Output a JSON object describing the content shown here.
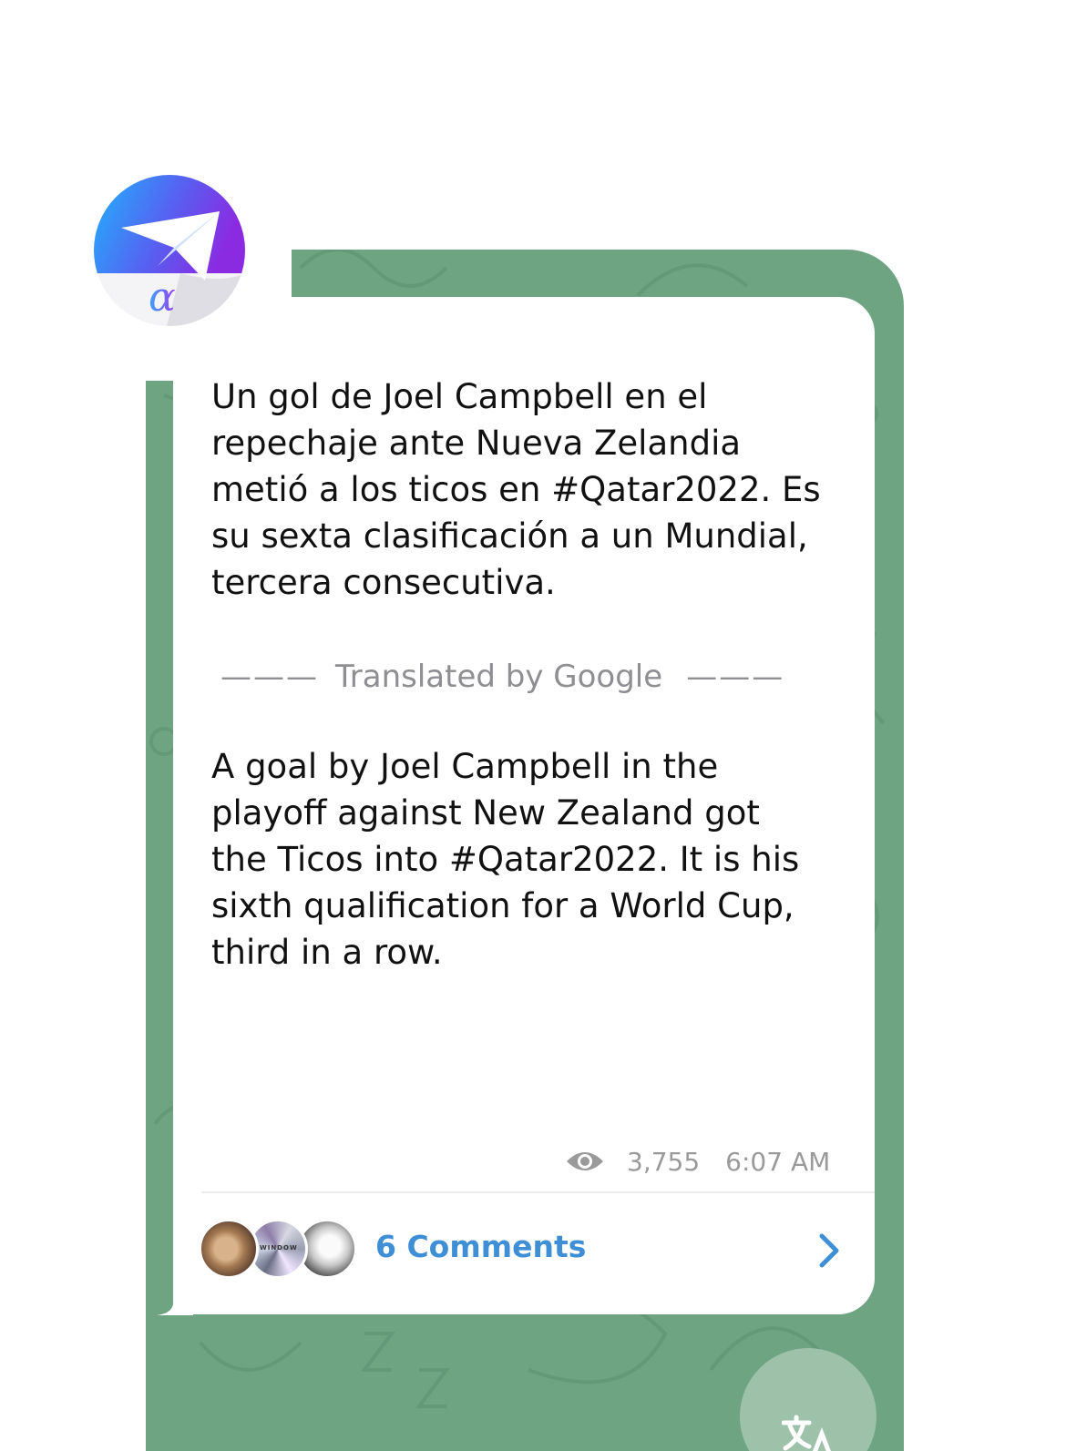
{
  "message": {
    "original_text": "Un gol de Joel Campbell en el\nrepechaje ante Nueva Zelandia\nmetió a los ticos en #Qatar2022. Es\nsu sexta clasificación a un Mundial,\ntercera consecutiva.",
    "translation_divider": {
      "left_dashes": "———",
      "label": "Translated by Google",
      "right_dashes": "———"
    },
    "translated_text": "A goal by Joel Campbell in the\nplayoff against New Zealand got\nthe Ticos into #Qatar2022. It is his\nsixth qualification for a World Cup,\nthird in a row.",
    "views": "3,755",
    "time": "6:07 AM"
  },
  "comments": {
    "label": "6 Comments",
    "avatar_2_text": "WINDOW"
  },
  "icons": {
    "app_badge": "paper-plane-alpha-icon",
    "views": "eye-icon",
    "comments_arrow": "chevron-right-icon",
    "translate": "translate-icon"
  },
  "colors": {
    "chat_background": "#6fa483",
    "link_blue": "#3f8fd6",
    "meta_gray": "#9a9a9a",
    "badge_gradient_start": "#1fb3ff",
    "badge_gradient_end": "#8a2be2"
  }
}
